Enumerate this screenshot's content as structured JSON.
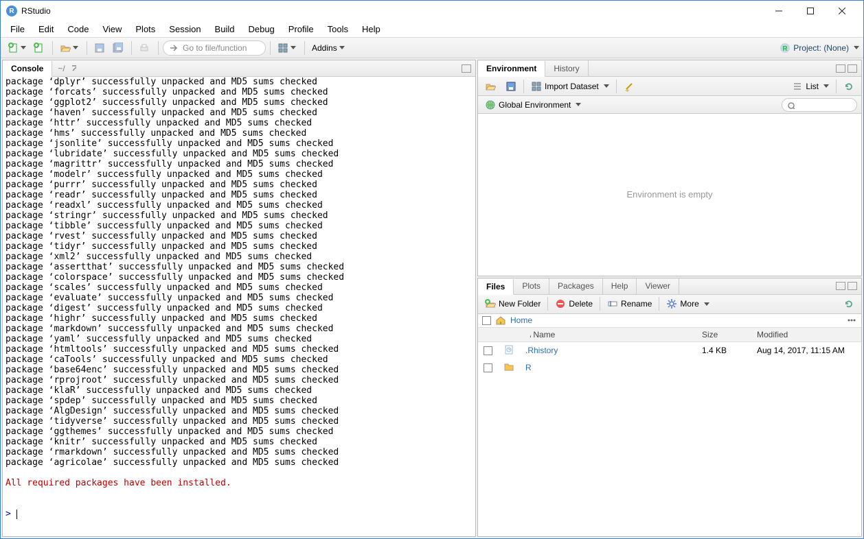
{
  "window": {
    "title": "RStudio"
  },
  "menu": [
    "File",
    "Edit",
    "Code",
    "View",
    "Plots",
    "Session",
    "Build",
    "Debug",
    "Profile",
    "Tools",
    "Help"
  ],
  "toolbar": {
    "goto_placeholder": "Go to file/function",
    "addins_label": "Addins",
    "project_label": "Project: (None)"
  },
  "left": {
    "console_tab": "Console",
    "console_path": "~/",
    "package_lines": [
      "package 'dplyr' successfully unpacked and MD5 sums checked",
      "package 'forcats' successfully unpacked and MD5 sums checked",
      "package 'ggplot2' successfully unpacked and MD5 sums checked",
      "package 'haven' successfully unpacked and MD5 sums checked",
      "package 'httr' successfully unpacked and MD5 sums checked",
      "package 'hms' successfully unpacked and MD5 sums checked",
      "package 'jsonlite' successfully unpacked and MD5 sums checked",
      "package 'lubridate' successfully unpacked and MD5 sums checked",
      "package 'magrittr' successfully unpacked and MD5 sums checked",
      "package 'modelr' successfully unpacked and MD5 sums checked",
      "package 'purrr' successfully unpacked and MD5 sums checked",
      "package 'readr' successfully unpacked and MD5 sums checked",
      "package 'readxl' successfully unpacked and MD5 sums checked",
      "package 'stringr' successfully unpacked and MD5 sums checked",
      "package 'tibble' successfully unpacked and MD5 sums checked",
      "package 'rvest' successfully unpacked and MD5 sums checked",
      "package 'tidyr' successfully unpacked and MD5 sums checked",
      "package 'xml2' successfully unpacked and MD5 sums checked",
      "package 'assertthat' successfully unpacked and MD5 sums checked",
      "package 'colorspace' successfully unpacked and MD5 sums checked",
      "package 'scales' successfully unpacked and MD5 sums checked",
      "package 'evaluate' successfully unpacked and MD5 sums checked",
      "package 'digest' successfully unpacked and MD5 sums checked",
      "package 'highr' successfully unpacked and MD5 sums checked",
      "package 'markdown' successfully unpacked and MD5 sums checked",
      "package 'yaml' successfully unpacked and MD5 sums checked",
      "package 'htmltools' successfully unpacked and MD5 sums checked",
      "package 'caTools' successfully unpacked and MD5 sums checked",
      "package 'base64enc' successfully unpacked and MD5 sums checked",
      "package 'rprojroot' successfully unpacked and MD5 sums checked",
      "package 'klaR' successfully unpacked and MD5 sums checked",
      "package 'spdep' successfully unpacked and MD5 sums checked",
      "package 'AlgDesign' successfully unpacked and MD5 sums checked",
      "package 'tidyverse' successfully unpacked and MD5 sums checked",
      "package 'ggthemes' successfully unpacked and MD5 sums checked",
      "package 'knitr' successfully unpacked and MD5 sums checked",
      "package 'rmarkdown' successfully unpacked and MD5 sums checked",
      "package 'agricolae' successfully unpacked and MD5 sums checked"
    ],
    "final_message": "All required packages have been installed.",
    "prompt": ">"
  },
  "right_top": {
    "tabs": [
      "Environment",
      "History"
    ],
    "import_label": "Import Dataset",
    "list_label": "List",
    "global_env_label": "Global Environment",
    "empty_message": "Environment is empty"
  },
  "right_bottom": {
    "tabs": [
      "Files",
      "Plots",
      "Packages",
      "Help",
      "Viewer"
    ],
    "new_folder": "New Folder",
    "delete": "Delete",
    "rename": "Rename",
    "more": "More",
    "breadcrumb_home": "Home",
    "columns": {
      "name": "Name",
      "size": "Size",
      "modified": "Modified"
    },
    "rows": [
      {
        "icon": "history-file-icon",
        "name": ".Rhistory",
        "size": "1.4 KB",
        "modified": "Aug 14, 2017, 11:15 AM"
      },
      {
        "icon": "folder-icon",
        "name": "R",
        "size": "",
        "modified": ""
      }
    ]
  }
}
